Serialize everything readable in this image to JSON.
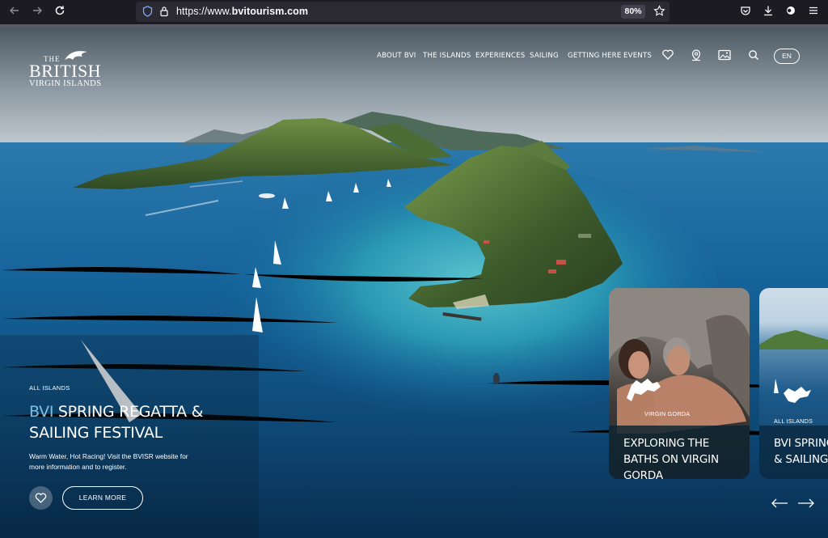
{
  "browser": {
    "url_prefix": "https://www.",
    "url_host": "bvitourism.com",
    "zoom": "80%"
  },
  "logo": {
    "the": "THE",
    "british": "BRITISH",
    "virgin_islands": "VIRGIN ISLANDS"
  },
  "nav": {
    "items": [
      "ABOUT BVI",
      "THE ISLANDS",
      "EXPERIENCES",
      "SAILING",
      "GETTING HERE",
      "EVENTS"
    ],
    "language": "EN"
  },
  "hero": {
    "tag": "ALL ISLANDS",
    "title_highlight": "BVI",
    "title_rest": " SPRING REGATTA & SAILING FESTIVAL",
    "description": "Warm Water, Hot Racing! Visit the BVISR website for more information and to register.",
    "cta": "LEARN MORE"
  },
  "cards": [
    {
      "tag": "VIRGIN GORDA",
      "title": "EXPLORING THE BATHS ON VIRGIN GORDA"
    },
    {
      "tag": "ALL ISLANDS",
      "title": "BVI SPRING REGATTA & SAILING FESTIVAL"
    }
  ],
  "icons": {
    "back": "arrow-left-icon",
    "forward": "arrow-right-icon",
    "reload": "reload-icon",
    "shield": "shield-icon",
    "lock": "lock-icon",
    "bookmark": "star-icon",
    "pocket": "pocket-icon",
    "download": "download-icon",
    "extension": "puzzle-icon",
    "menu": "hamburger-icon",
    "favorites": "heart-icon",
    "map": "map-pin-icon",
    "gallery": "image-icon",
    "search": "search-icon"
  },
  "colors": {
    "chrome_bg": "#1c1b22",
    "urlbar_bg": "#2b2a33",
    "accent_title": "#7fc1e6"
  }
}
